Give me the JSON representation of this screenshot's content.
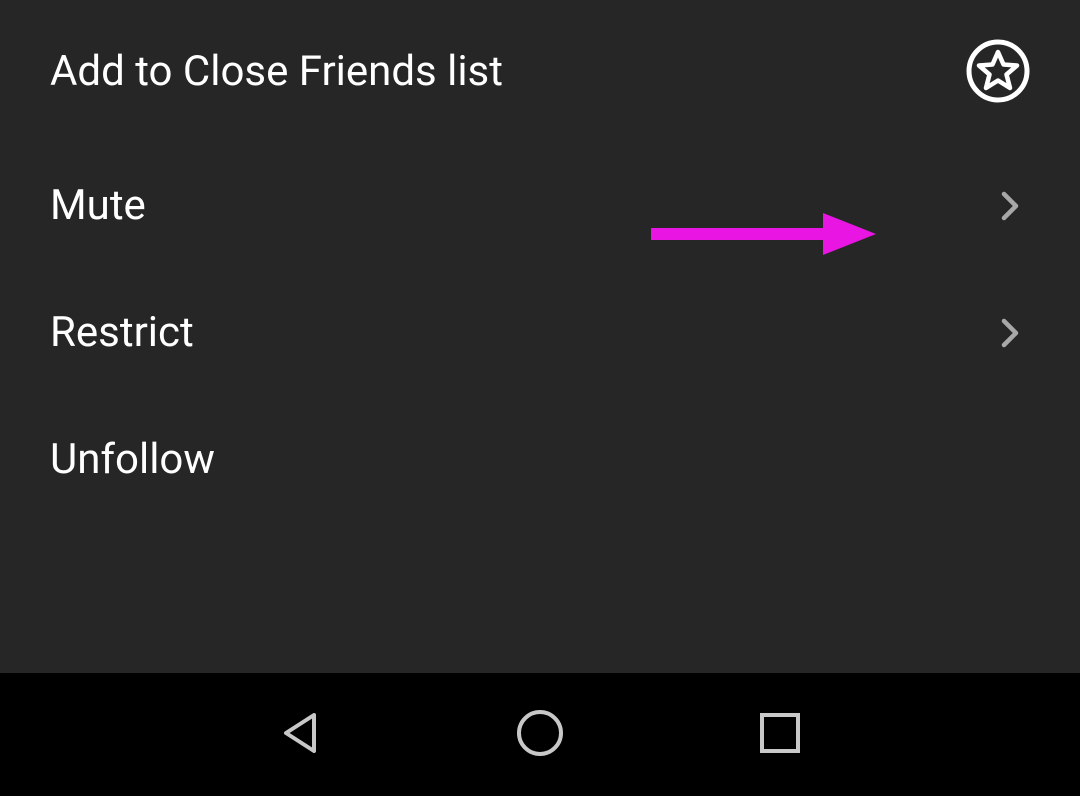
{
  "menu": {
    "items": [
      {
        "label": "Add to Close Friends list",
        "icon": "star-circle",
        "has_chevron": false
      },
      {
        "label": "Mute",
        "icon": null,
        "has_chevron": true
      },
      {
        "label": "Restrict",
        "icon": null,
        "has_chevron": true
      },
      {
        "label": "Unfollow",
        "icon": null,
        "has_chevron": false
      }
    ]
  },
  "annotation": {
    "arrow_color": "#E815E3"
  },
  "colors": {
    "background": "#262626",
    "text": "#ffffff",
    "chevron": "#a8a8a8",
    "nav_bg": "#000000",
    "nav_icon": "#c8c8c8"
  }
}
